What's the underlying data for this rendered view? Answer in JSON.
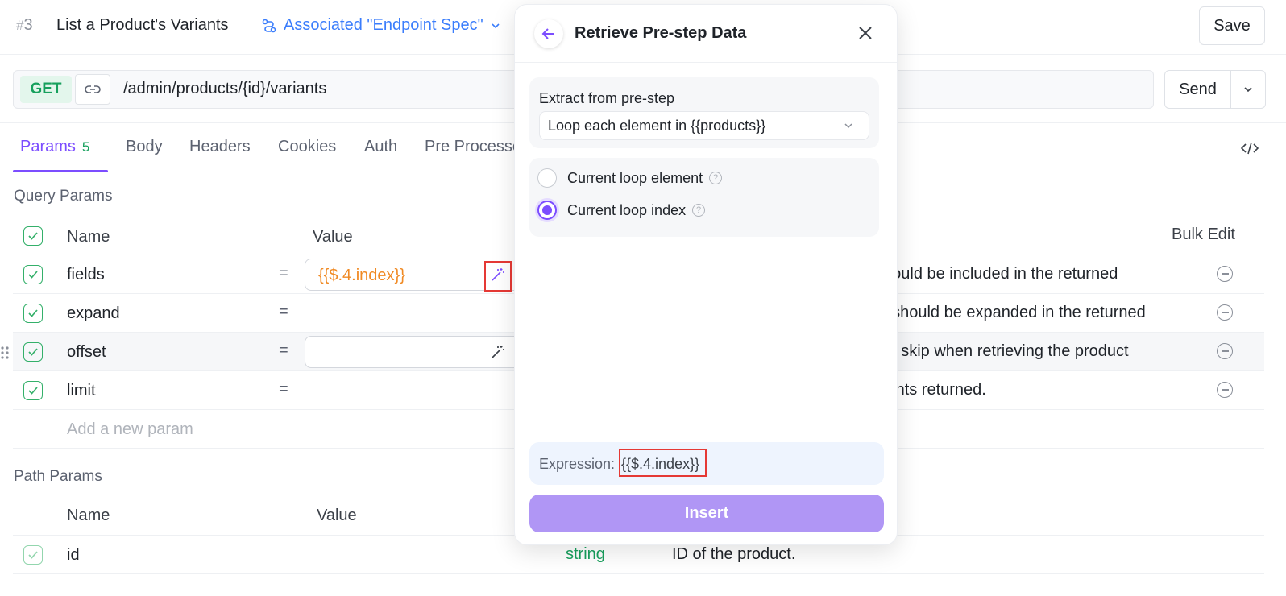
{
  "header": {
    "hash": "#",
    "index": "3",
    "title": "List a Product's Variants",
    "associated": "Associated \"Endpoint Spec\"",
    "save_label": "Save"
  },
  "request": {
    "method": "GET",
    "url": "/admin/products/{id}/variants",
    "send_label": "Send"
  },
  "tabs": [
    {
      "label": "Params",
      "count": "5"
    },
    {
      "label": "Body"
    },
    {
      "label": "Headers"
    },
    {
      "label": "Cookies"
    },
    {
      "label": "Auth"
    },
    {
      "label": "Pre Processe"
    }
  ],
  "query": {
    "title": "Query Params",
    "col_name": "Name",
    "col_value": "Value",
    "bulk_edit": "Bulk Edit",
    "rows": [
      {
        "name": "fields",
        "value": "{{$.4.index}}",
        "desc": "hould be included in the returned"
      },
      {
        "name": "expand",
        "value": "",
        "desc": "t should be expanded in the returned"
      },
      {
        "name": "offset",
        "value": "",
        "desc": "to skip when retrieving the product"
      },
      {
        "name": "limit",
        "value": "",
        "desc": "iants returned."
      }
    ],
    "add_placeholder": "Add a new param"
  },
  "path": {
    "title": "Path Params",
    "col_name": "Name",
    "col_value": "Value",
    "rows": [
      {
        "name": "id",
        "type": "string",
        "desc": "ID of the product."
      }
    ]
  },
  "modal": {
    "title": "Retrieve Pre-step Data",
    "extract_label": "Extract from pre-step",
    "extract_value": "Loop each element in {{products}}",
    "option_element": "Current loop element",
    "option_index": "Current loop index",
    "help": "?",
    "expression_label": "Expression:",
    "expression_value": "{{$.4.index}}",
    "insert_label": "Insert"
  },
  "colors": {
    "accent": "#7c4dff",
    "get": "#17a05d",
    "link": "#3a7dfc",
    "variable": "#f08a24",
    "highlight": "#e53935"
  }
}
